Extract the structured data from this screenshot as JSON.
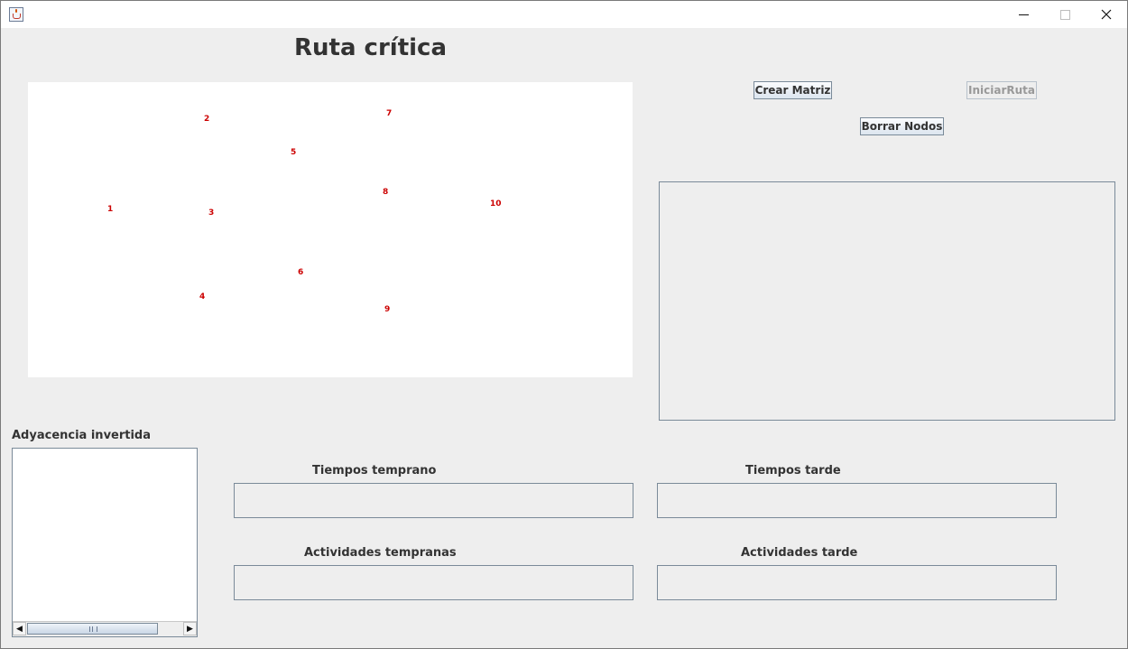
{
  "window": {
    "title": "",
    "controls": {
      "minimize_icon": "minimize-icon",
      "maximize_icon": "maximize-icon",
      "close_icon": "close-icon"
    }
  },
  "heading": "Ruta crítica",
  "graph": {
    "nodes": [
      {
        "label": "1"
      },
      {
        "label": "2"
      },
      {
        "label": "3"
      },
      {
        "label": "4"
      },
      {
        "label": "5"
      },
      {
        "label": "6"
      },
      {
        "label": "7"
      },
      {
        "label": "8"
      },
      {
        "label": "9"
      },
      {
        "label": "10"
      }
    ],
    "node_color": "#cc0000"
  },
  "buttons": {
    "crear_matriz": "Crear Matriz",
    "iniciar_ruta": "IniciarRuta",
    "borrar_nodos": "Borrar Nodos"
  },
  "labels": {
    "adyacencia": "Adyacencia invertida",
    "tiempos_temprano": "Tiempos temprano",
    "tiempos_tarde": "Tiempos tarde",
    "actividades_tempranas": "Actividades tempranas",
    "actividades_tarde": "Actividades tarde"
  },
  "fields": {
    "tiempos_temprano": "",
    "tiempos_tarde": "",
    "actividades_tempranas": "",
    "actividades_tarde": ""
  }
}
